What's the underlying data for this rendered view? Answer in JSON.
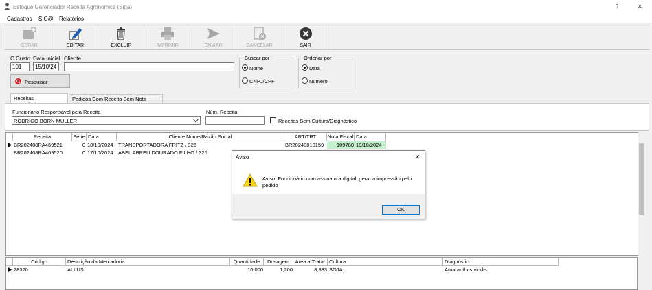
{
  "window": {
    "title": "Estoque Gerenciador Receita Agronomica (Siga)",
    "help_glyph": "?",
    "close_glyph": "✕"
  },
  "menu": [
    "Cadastros",
    "SIG@",
    "Relatórios"
  ],
  "toolbar": [
    {
      "label": "GERAR",
      "icon": "add-form-icon",
      "enabled": false
    },
    {
      "label": "EDITAR",
      "icon": "pencil-icon",
      "enabled": true
    },
    {
      "label": "EXCLUIR",
      "icon": "trash-icon",
      "enabled": true
    },
    {
      "label": "IMPRIMIR",
      "icon": "printer-icon",
      "enabled": false
    },
    {
      "label": "ENVIAR",
      "icon": "send-icon",
      "enabled": false
    },
    {
      "label": "CANCELAR",
      "icon": "cancel-doc-icon",
      "enabled": false
    },
    {
      "label": "SAIR",
      "icon": "exit-icon",
      "enabled": true
    }
  ],
  "filters": {
    "c_custo_label": "C.Custo",
    "c_custo": "101",
    "data_inicial_label": "Data Inicial",
    "data_inicial": "15/10/24",
    "cliente_label": "Cliente",
    "cliente": "",
    "pesquisar": "Pesquisar",
    "buscar_por": {
      "title": "Buscar por",
      "options": [
        "Nome",
        "CNPJ/CPF"
      ],
      "selected": "Nome"
    },
    "ordenar_por": {
      "title": "Ordenar por",
      "options": [
        "Data",
        "Numero"
      ],
      "selected": "Data"
    }
  },
  "tabs": [
    "Receitas Agronômicas",
    "Pedidos Com Receita Sem Nota Fiscal"
  ],
  "panel": {
    "funcionario_label": "Funcionário Responsável pela Receita",
    "funcionario": "RODRIGO BORN MULLER",
    "num_receita_label": "Núm. Receita",
    "num_receita": "",
    "sem_cultura_label": "Receitas Sem Cultura/Diagnóstico"
  },
  "receitas": {
    "columns": [
      "Receita",
      "Série",
      "Data",
      "Cliente Nome/Razão Social",
      "ART/TRT",
      "Nota Fiscal",
      "Data"
    ],
    "rows": [
      {
        "receita": "BR202408RA469521",
        "serie": "0",
        "data": "18/10/2024",
        "cliente": "TRANSPORTADORA FRITZ / 326",
        "art": "BR20240810159",
        "nota": "109788",
        "data_nf": "18/10/2024"
      },
      {
        "receita": "BR202408RA469520",
        "serie": "0",
        "data": "17/10/2024",
        "cliente": "ABEL ABREU DOURADO FILHO / 325",
        "art": "",
        "nota": "",
        "data_nf": ""
      }
    ],
    "highlight_color": "#c6efce"
  },
  "itens": {
    "columns": [
      "Código",
      "Descrição da Mercadoria",
      "Quantidade",
      "Dosagem",
      "Area a Tratar",
      "Cultura",
      "Diagnóstico"
    ],
    "rows": [
      {
        "codigo": "28320",
        "descricao": "ALLUS",
        "quantidade": "10,000",
        "dosagem": "1,200",
        "area": "8,333",
        "cultura": "SOJA",
        "diagnostico": "Amaranthus viridis"
      }
    ]
  },
  "dialog": {
    "title": "Aviso",
    "message": "Aviso: Funcionário com assinatura digital, gerar a impressão pelo pedido",
    "ok": "OK",
    "close_glyph": "✕"
  }
}
